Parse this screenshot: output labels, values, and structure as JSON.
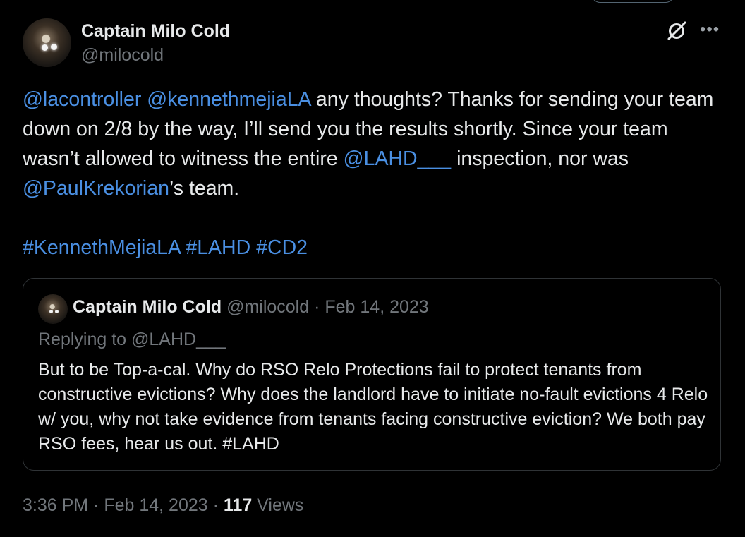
{
  "author": {
    "name": "Captain Milo Cold",
    "handle": "@milocold"
  },
  "tweet": {
    "parts": [
      {
        "text": "@lacontroller",
        "link": true
      },
      {
        "text": " ",
        "link": false
      },
      {
        "text": "@kennethmejiaLA",
        "link": true
      },
      {
        "text": " any thoughts? Thanks for sending your team down on 2/8 by the way, I’ll send you the results shortly. Since your team wasn’t allowed to witness the entire ",
        "link": false
      },
      {
        "text": "@LAHD___",
        "link": true
      },
      {
        "text": " inspection, nor was ",
        "link": false
      },
      {
        "text": "@PaulKrekorian",
        "link": true
      },
      {
        "text": "’s team.\n\n",
        "link": false
      },
      {
        "text": "#KennethMejiaLA",
        "link": true
      },
      {
        "text": " ",
        "link": false
      },
      {
        "text": "#LAHD",
        "link": true
      },
      {
        "text": " ",
        "link": false
      },
      {
        "text": "#CD2",
        "link": true
      }
    ]
  },
  "quote": {
    "name": "Captain Milo Cold",
    "meta": "@milocold · Feb 14, 2023",
    "replying_to": "Replying to @LAHD___",
    "text": "But to be Top-a-cal. Why do RSO Relo Protections fail to protect tenants from constructive evictions? Why does the landlord have to initiate no-fault evictions 4 Relo w/ you, why not take evidence from tenants facing constructive eviction? We both pay RSO fees, hear us out. #LAHD"
  },
  "footer": {
    "timestamp": "3:36 PM · Feb 14, 2023 · ",
    "views_count": "117",
    "views_label": " Views"
  },
  "icons": {
    "grok": "grok-icon",
    "more": "more-icon",
    "avatar": "avatar"
  },
  "colors": {
    "link": "#4a8fe2",
    "muted": "#71767b",
    "background": "#000000"
  }
}
